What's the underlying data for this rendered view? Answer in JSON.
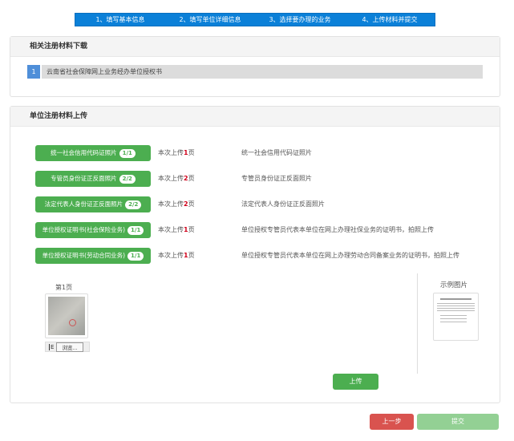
{
  "steps": [
    "1、填写基本信息",
    "2、填写单位详细信息",
    "3、选择要办理的业务",
    "4、上传材料并提交"
  ],
  "download": {
    "title": "相关注册材料下载",
    "items": [
      {
        "num": "1",
        "label": "云南省社会保障网上业务经办单位授权书"
      }
    ]
  },
  "upload": {
    "title": "单位注册材料上传",
    "items": [
      {
        "label": "统一社会信用代码证照片",
        "badge": "1/1",
        "pre": "本次上传",
        "count": "1",
        "post": "页",
        "desc": "统一社会信用代码证照片"
      },
      {
        "label": "专管员身份证正反面照片",
        "badge": "2/2",
        "pre": "本次上传",
        "count": "2",
        "post": "页",
        "desc": "专管员身份证正反面照片"
      },
      {
        "label": "法定代表人身份证正反面照片",
        "badge": "2/2",
        "pre": "本次上传",
        "count": "2",
        "post": "页",
        "desc": "法定代表人身份证正反面照片"
      },
      {
        "label": "单位授权证明书(社会保险业务)",
        "badge": "1/1",
        "pre": "本次上传",
        "count": "1",
        "post": "页",
        "desc": "单位授权专管员代表本单位在网上办理社保业务的证明书，拍照上传"
      },
      {
        "label": "单位授权证明书(劳动合同业务)",
        "badge": "1/1",
        "pre": "本次上传",
        "count": "1",
        "post": "页",
        "desc": "单位授权专管员代表本单位在网上办理劳动合同备案业务的证明书，拍照上传"
      }
    ],
    "page_label": "第1页",
    "browse_label": "浏览...",
    "sample_label": "示例图片",
    "upload_button": "上传"
  },
  "footer": {
    "prev": "上一步",
    "submit": "提交"
  },
  "colors": {
    "step_bar": "#0b80d8",
    "green": "#4cae50",
    "red": "#d9534f",
    "submit_disabled": "#93d094"
  }
}
